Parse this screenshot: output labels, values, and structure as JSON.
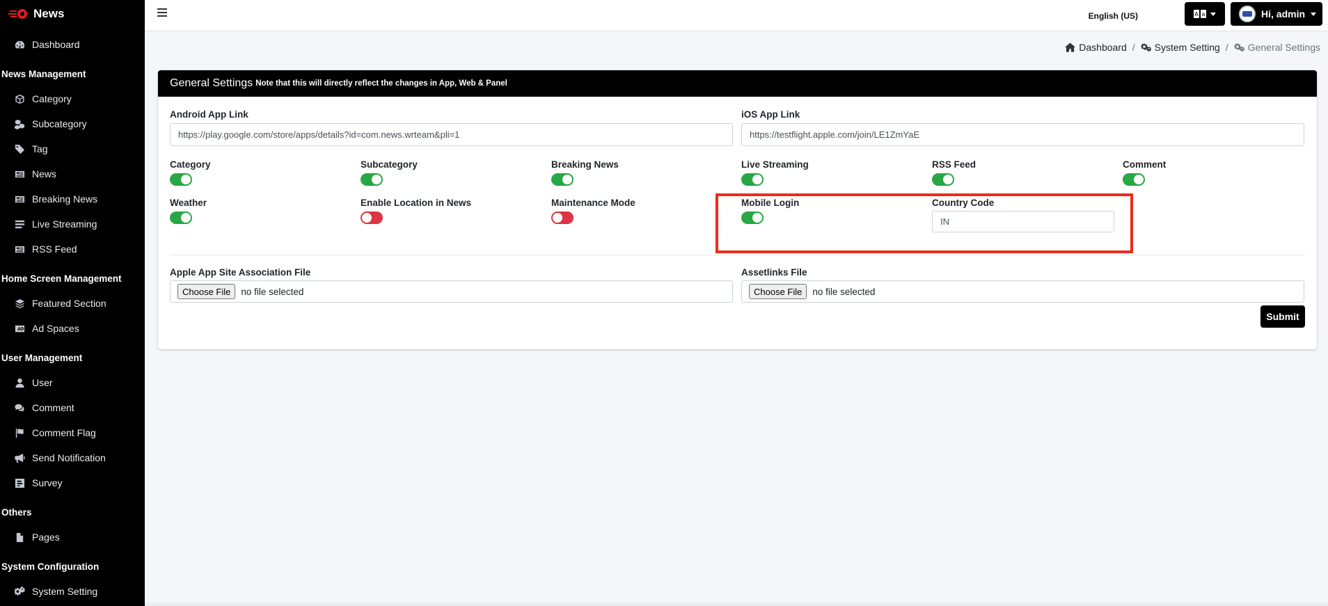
{
  "brand": {
    "name": "News"
  },
  "sidebar": {
    "dashboard": {
      "label": "Dashboard",
      "icon": "tachometer-icon"
    },
    "sections": [
      {
        "header": "News Management",
        "items": [
          {
            "label": "Category",
            "icon": "cube-icon"
          },
          {
            "label": "Subcategory",
            "icon": "cubes-icon"
          },
          {
            "label": "Tag",
            "icon": "tag-icon"
          },
          {
            "label": "News",
            "icon": "newspaper-icon"
          },
          {
            "label": "Breaking News",
            "icon": "newspaper-icon"
          },
          {
            "label": "Live Streaming",
            "icon": "list-icon"
          },
          {
            "label": "RSS Feed",
            "icon": "newspaper-icon"
          }
        ]
      },
      {
        "header": "Home Screen Management",
        "items": [
          {
            "label": "Featured Section",
            "icon": "layers-icon"
          },
          {
            "label": "Ad Spaces",
            "icon": "ad-icon"
          }
        ]
      },
      {
        "header": "User Management",
        "items": [
          {
            "label": "User",
            "icon": "user-icon"
          },
          {
            "label": "Comment",
            "icon": "comments-icon"
          },
          {
            "label": "Comment Flag",
            "icon": "flag-icon"
          },
          {
            "label": "Send Notification",
            "icon": "bullhorn-icon"
          },
          {
            "label": "Survey",
            "icon": "poll-icon"
          }
        ]
      },
      {
        "header": "Others",
        "items": [
          {
            "label": "Pages",
            "icon": "file-icon"
          }
        ]
      },
      {
        "header": "System Configuration",
        "items": [
          {
            "label": "System Setting",
            "icon": "cogs-icon"
          }
        ]
      }
    ]
  },
  "topbar": {
    "language": "English (US)",
    "user_greeting": "Hi, admin"
  },
  "breadcrumb": [
    {
      "label": "Dashboard",
      "icon": "home-icon"
    },
    {
      "label": "System Setting",
      "icon": "cogs-icon"
    },
    {
      "label": "General Settings",
      "icon": "cogs-icon"
    }
  ],
  "card": {
    "title": "General Settings",
    "note": "Note that this will directly reflect the changes in App, Web & Panel"
  },
  "form": {
    "android_label": "Android App Link",
    "android_value": "https://play.google.com/store/apps/details?id=com.news.wrteam&pli=1",
    "ios_label": "iOS App Link",
    "ios_value": "https://testflight.apple.com/join/LE1ZmYaE",
    "toggles": [
      {
        "label": "Category",
        "on": true
      },
      {
        "label": "Subcategory",
        "on": true
      },
      {
        "label": "Breaking News",
        "on": true
      },
      {
        "label": "Live Streaming",
        "on": true
      },
      {
        "label": "RSS Feed",
        "on": true
      },
      {
        "label": "Comment",
        "on": true
      },
      {
        "label": "Weather",
        "on": true
      },
      {
        "label": "Enable Location in News",
        "on": false
      },
      {
        "label": "Maintenance Mode",
        "on": false
      },
      {
        "label": "Mobile Login",
        "on": true
      }
    ],
    "country_code_label": "Country Code",
    "country_code_value": "IN",
    "apple_file_label": "Apple App Site Association File",
    "assetlinks_label": "Assetlinks File",
    "choose_file": "Choose File",
    "no_file": "no file selected",
    "submit": "Submit"
  },
  "colors": {
    "toggle_on": "#28a745",
    "toggle_off": "#dc3545",
    "highlight": "#ee2b1b"
  }
}
